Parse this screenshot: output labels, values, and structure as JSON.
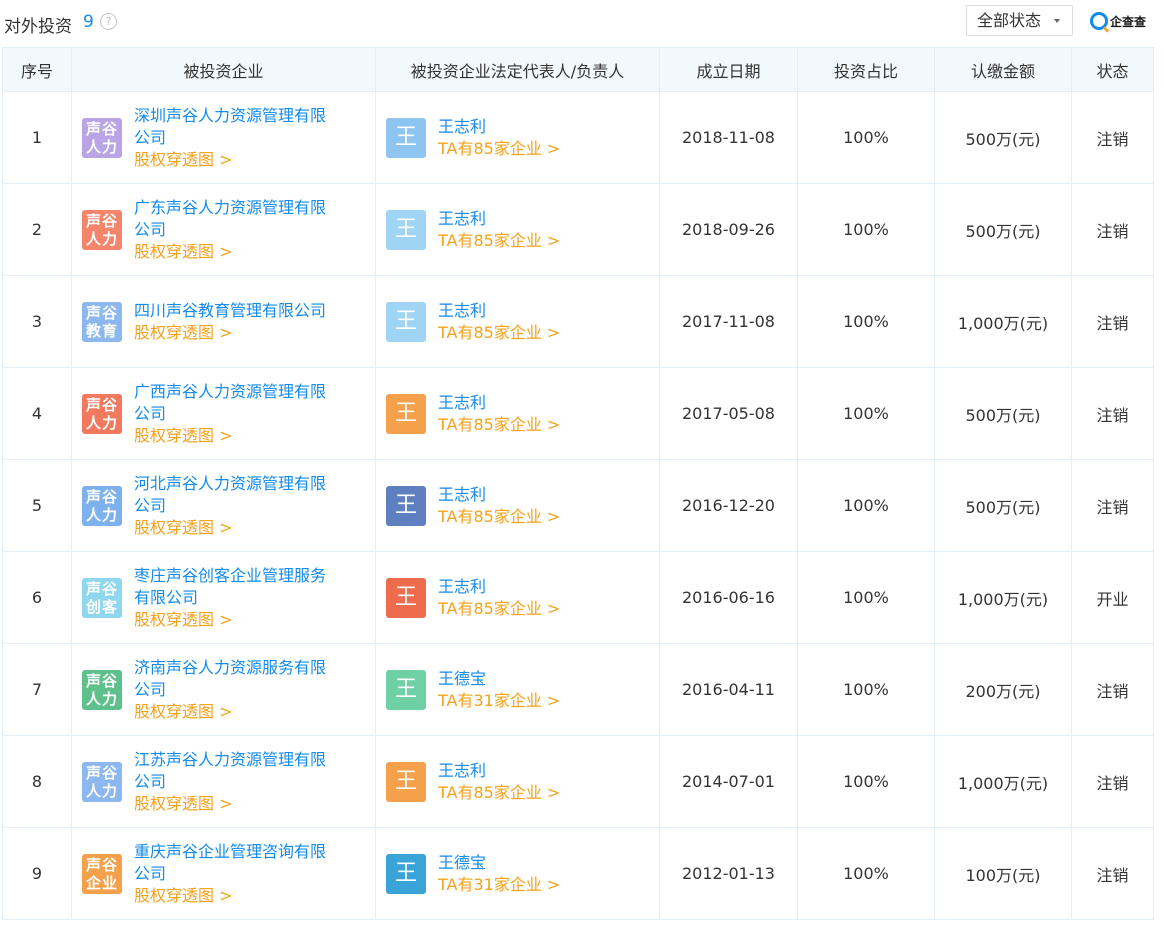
{
  "header": {
    "title": "对外投资",
    "count": "9",
    "help_icon": "?",
    "filter_label": "全部状态",
    "brand": "企查查"
  },
  "table": {
    "columns": [
      "序号",
      "被投资企业",
      "被投资企业法定代表人/负责人",
      "成立日期",
      "投资占比",
      "认缴金额",
      "状态"
    ],
    "rows": [
      {
        "no": "1",
        "logo": [
          "声谷",
          "人力"
        ],
        "logo_color": "#b9a5e6",
        "name": "深圳声谷人力资源管理有限公司",
        "name_lines": [
          "深圳声谷人力资源管理有限",
          "公司"
        ],
        "link": "股权穿透图 >",
        "avatar": "王",
        "avatar_color": "#8ec5f0",
        "person": "王志利",
        "person_link": "TA有85家企业 >",
        "date": "2018-11-08",
        "ratio": "100%",
        "amount": "500万(元)",
        "status": "注销",
        "status_type": "cancel"
      },
      {
        "no": "2",
        "logo": [
          "声谷",
          "人力"
        ],
        "logo_color": "#f4846a",
        "name": "广东声谷人力资源管理有限公司",
        "name_lines": [
          "广东声谷人力资源管理有限",
          "公司"
        ],
        "link": "股权穿透图 >",
        "avatar": "王",
        "avatar_color": "#9fd4f5",
        "person": "王志利",
        "person_link": "TA有85家企业 >",
        "date": "2018-09-26",
        "ratio": "100%",
        "amount": "500万(元)",
        "status": "注销",
        "status_type": "cancel"
      },
      {
        "no": "3",
        "logo": [
          "声谷",
          "教育"
        ],
        "logo_color": "#8cb8ef",
        "name": "四川声谷教育管理有限公司",
        "name_lines": [
          "四川声谷教育管理有限公司"
        ],
        "link": "股权穿透图 >",
        "avatar": "王",
        "avatar_color": "#9fd4f5",
        "person": "王志利",
        "person_link": "TA有85家企业 >",
        "date": "2017-11-08",
        "ratio": "100%",
        "amount": "1,000万(元)",
        "status": "注销",
        "status_type": "cancel"
      },
      {
        "no": "4",
        "logo": [
          "声谷",
          "人力"
        ],
        "logo_color": "#f2785e",
        "name": "广西声谷人力资源管理有限公司",
        "name_lines": [
          "广西声谷人力资源管理有限",
          "公司"
        ],
        "link": "股权穿透图 >",
        "avatar": "王",
        "avatar_color": "#f5a04a",
        "person": "王志利",
        "person_link": "TA有85家企业 >",
        "date": "2017-05-08",
        "ratio": "100%",
        "amount": "500万(元)",
        "status": "注销",
        "status_type": "cancel"
      },
      {
        "no": "5",
        "logo": [
          "声谷",
          "人力"
        ],
        "logo_color": "#7db1ee",
        "name": "河北声谷人力资源管理有限公司",
        "name_lines": [
          "河北声谷人力资源管理有限",
          "公司"
        ],
        "link": "股权穿透图 >",
        "avatar": "王",
        "avatar_color": "#5e7fc0",
        "person": "王志利",
        "person_link": "TA有85家企业 >",
        "date": "2016-12-20",
        "ratio": "100%",
        "amount": "500万(元)",
        "status": "注销",
        "status_type": "cancel"
      },
      {
        "no": "6",
        "logo": [
          "声谷",
          "创客"
        ],
        "logo_color": "#8fd6ef",
        "name": "枣庄声谷创客企业管理服务有限公司",
        "name_lines": [
          "枣庄声谷创客企业管理服务",
          "有限公司"
        ],
        "link": "股权穿透图 >",
        "avatar": "王",
        "avatar_color": "#ee6c4d",
        "person": "王志利",
        "person_link": "TA有85家企业 >",
        "date": "2016-06-16",
        "ratio": "100%",
        "amount": "1,000万(元)",
        "status": "开业",
        "status_type": "open"
      },
      {
        "no": "7",
        "logo": [
          "声谷",
          "人力"
        ],
        "logo_color": "#5ec08a",
        "name": "济南声谷人力资源服务有限公司",
        "name_lines": [
          "济南声谷人力资源服务有限",
          "公司"
        ],
        "link": "股权穿透图 >",
        "avatar": "王",
        "avatar_color": "#6fcfa5",
        "person": "王德宝",
        "person_link": "TA有31家企业 >",
        "date": "2016-04-11",
        "ratio": "100%",
        "amount": "200万(元)",
        "status": "注销",
        "status_type": "cancel"
      },
      {
        "no": "8",
        "logo": [
          "声谷",
          "人力"
        ],
        "logo_color": "#8cb8ef",
        "name": "江苏声谷人力资源管理有限公司",
        "name_lines": [
          "江苏声谷人力资源管理有限",
          "公司"
        ],
        "link": "股权穿透图 >",
        "avatar": "王",
        "avatar_color": "#f5a04a",
        "person": "王志利",
        "person_link": "TA有85家企业 >",
        "date": "2014-07-01",
        "ratio": "100%",
        "amount": "1,000万(元)",
        "status": "注销",
        "status_type": "cancel"
      },
      {
        "no": "9",
        "logo": [
          "声谷",
          "企业"
        ],
        "logo_color": "#f5a04a",
        "name": "重庆声谷企业管理咨询有限公司",
        "name_lines": [
          "重庆声谷企业管理咨询有限",
          "公司"
        ],
        "link": "股权穿透图 >",
        "avatar": "王",
        "avatar_color": "#3aa3d8",
        "person": "王德宝",
        "person_link": "TA有31家企业 >",
        "date": "2012-01-13",
        "ratio": "100%",
        "amount": "100万(元)",
        "status": "注销",
        "status_type": "cancel"
      }
    ]
  }
}
